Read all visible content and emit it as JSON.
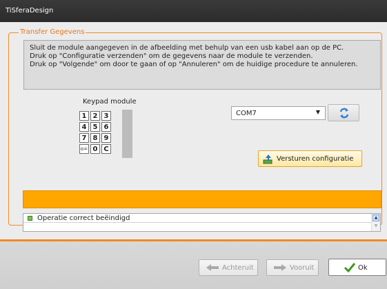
{
  "window": {
    "title": "TiSferaDesign"
  },
  "group": {
    "title": "Transfer Gegevens"
  },
  "instructions": {
    "line1": "Sluit de module aangegeven in de afbeelding met behulp van een usb kabel aan op de PC.",
    "line2": "Druk op \"Configuratie verzenden\" om de gegevens naar de module te verzenden.",
    "line3": "Druk op \"Volgende\" om door te gaan of op \"Annuleren\" om de huidige procedure te annuleren."
  },
  "keypad": {
    "title": "Keypad module",
    "keys": [
      "1",
      "2",
      "3",
      "4",
      "5",
      "6",
      "7",
      "8",
      "9",
      "o=",
      "0",
      "C"
    ]
  },
  "port": {
    "selected": "COM7"
  },
  "send_button": {
    "label": "Versturen configuratie"
  },
  "progress": {
    "value": 1.0,
    "color": "#ffa600"
  },
  "log": {
    "entries": [
      "Operatie correct beëindigd"
    ]
  },
  "footer": {
    "back_label": "Achteruit",
    "forward_label": "Vooruit",
    "ok_label": "Ok"
  },
  "icons": {
    "refresh": "refresh-icon",
    "send": "upload-icon",
    "ok": "checkmark-icon"
  }
}
